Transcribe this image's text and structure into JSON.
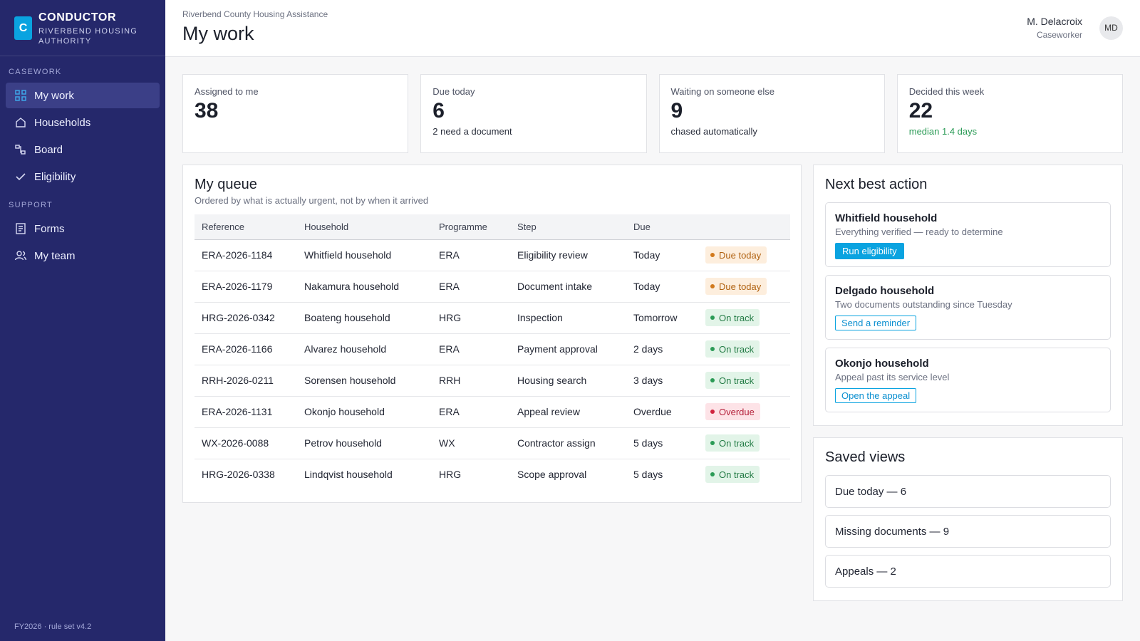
{
  "brand": {
    "logo_letter": "C",
    "name": "CONDUCTOR",
    "subtitle": "RIVERBEND HOUSING AUTHORITY"
  },
  "sidebar": {
    "sections": [
      {
        "label": "CASEWORK",
        "items": [
          {
            "label": "My work",
            "icon": "grid-icon",
            "active": true
          },
          {
            "label": "Households",
            "icon": "home-icon"
          },
          {
            "label": "Board",
            "icon": "board-icon"
          },
          {
            "label": "Eligibility",
            "icon": "check-icon"
          }
        ]
      },
      {
        "label": "SUPPORT",
        "items": [
          {
            "label": "Forms",
            "icon": "document-icon"
          },
          {
            "label": "My team",
            "icon": "team-icon"
          }
        ]
      }
    ],
    "footer": "FY2026 · rule set v4.2"
  },
  "header": {
    "org": "Riverbend County Housing Assistance",
    "title": "My work"
  },
  "user": {
    "name": "M. Delacroix",
    "role": "Caseworker",
    "initials": "MD"
  },
  "stats": [
    {
      "label": "Assigned to me",
      "value": "38",
      "sub": ""
    },
    {
      "label": "Due today",
      "value": "6",
      "sub": "2 need a document"
    },
    {
      "label": "Waiting on someone else",
      "value": "9",
      "sub": "chased automatically"
    },
    {
      "label": "Decided this week",
      "value": "22",
      "sub": "median 1.4 days"
    }
  ],
  "queue": {
    "title": "My queue",
    "subtitle": "Ordered by what is actually urgent, not by when it arrived",
    "columns": [
      "Reference",
      "Household",
      "Programme",
      "Step",
      "Due",
      ""
    ],
    "rows": [
      {
        "ref": "ERA-2026-1184",
        "household": "Whitfield household",
        "programme": "ERA",
        "step": "Eligibility review",
        "due": "Today",
        "status": "Due today",
        "tone": "warn"
      },
      {
        "ref": "ERA-2026-1179",
        "household": "Nakamura household",
        "programme": "ERA",
        "step": "Document intake",
        "due": "Today",
        "status": "Due today",
        "tone": "warn"
      },
      {
        "ref": "HRG-2026-0342",
        "household": "Boateng household",
        "programme": "HRG",
        "step": "Inspection",
        "due": "Tomorrow",
        "status": "On track",
        "tone": "ok"
      },
      {
        "ref": "ERA-2026-1166",
        "household": "Alvarez household",
        "programme": "ERA",
        "step": "Payment approval",
        "due": "2 days",
        "status": "On track",
        "tone": "ok"
      },
      {
        "ref": "RRH-2026-0211",
        "household": "Sorensen household",
        "programme": "RRH",
        "step": "Housing search",
        "due": "3 days",
        "status": "On track",
        "tone": "ok"
      },
      {
        "ref": "ERA-2026-1131",
        "household": "Okonjo household",
        "programme": "ERA",
        "step": "Appeal review",
        "due": "Overdue",
        "status": "Overdue",
        "tone": "bad"
      },
      {
        "ref": "WX-2026-0088",
        "household": "Petrov household",
        "programme": "WX",
        "step": "Contractor assign",
        "due": "5 days",
        "status": "On track",
        "tone": "ok"
      },
      {
        "ref": "HRG-2026-0338",
        "household": "Lindqvist household",
        "programme": "HRG",
        "step": "Scope approval",
        "due": "5 days",
        "status": "On track",
        "tone": "ok"
      }
    ]
  },
  "next_best_action": {
    "title": "Next best action",
    "items": [
      {
        "title": "Whitfield household",
        "desc": "Everything verified — ready to determine",
        "action": "Run eligibility",
        "style": "solid"
      },
      {
        "title": "Delgado household",
        "desc": "Two documents outstanding since Tuesday",
        "action": "Send a reminder",
        "style": "outline"
      },
      {
        "title": "Okonjo household",
        "desc": "Appeal past its service level",
        "action": "Open the appeal",
        "style": "outline"
      }
    ]
  },
  "saved_views": {
    "title": "Saved views",
    "items": [
      "Due today — 6",
      "Missing documents — 9",
      "Appeals — 2"
    ]
  },
  "colors": {
    "sidebar": "#25286b",
    "accent": "#0aa3e0",
    "warn": "#b06110",
    "ok": "#237b45",
    "bad": "#b4203a"
  }
}
